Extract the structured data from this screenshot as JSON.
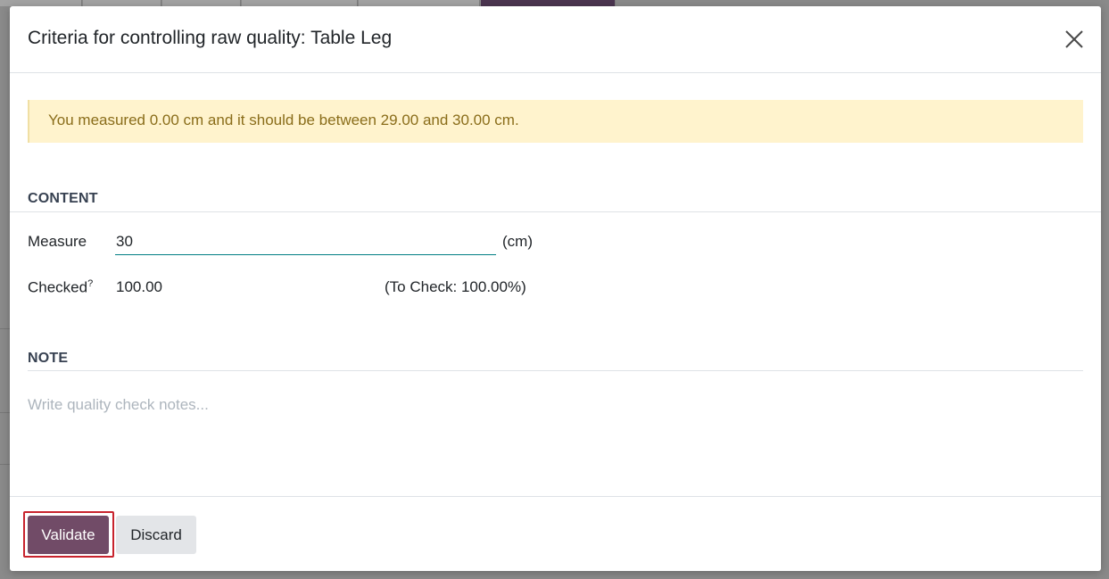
{
  "modal": {
    "title": "Criteria for controlling raw quality: Table Leg"
  },
  "alert": {
    "text": "You measured 0.00 cm and it should be between 29.00 and 30.00 cm."
  },
  "content_section": {
    "title": "CONTENT",
    "measure": {
      "label": "Measure",
      "value": "30",
      "unit": "(cm)"
    },
    "checked": {
      "label": "Checked",
      "tooltip_marker": "?",
      "value": "100.00",
      "to_check": "(To Check: 100.00%)"
    }
  },
  "note_section": {
    "title": "NOTE",
    "placeholder": "Write quality check notes..."
  },
  "footer": {
    "validate_label": "Validate",
    "discard_label": "Discard"
  },
  "colors": {
    "primary": "#714b67",
    "alert_bg": "#fff3cd",
    "alert_text": "#8a6d1a",
    "input_underline": "#017e84",
    "focus_outline": "#c8232d"
  }
}
